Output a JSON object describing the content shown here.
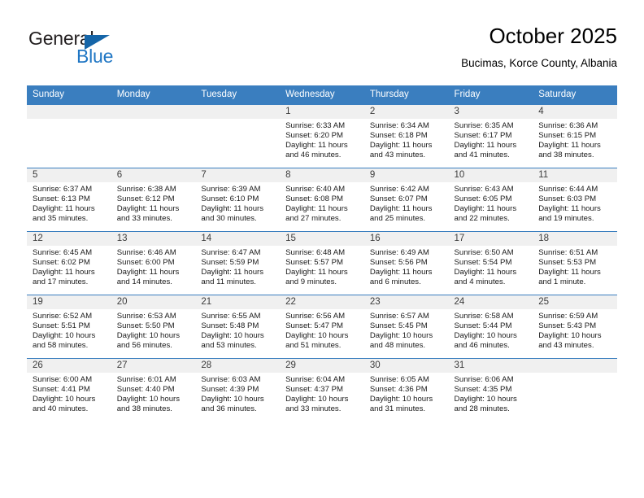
{
  "brand": {
    "name_part1": "General",
    "name_part2": "Blue",
    "triangle_icon": "triangle-icon",
    "accent_color": "#1f76c4",
    "dark_color": "#231f20"
  },
  "header": {
    "title": "October 2025",
    "subtitle": "Bucimas, Korce County, Albania"
  },
  "calendar": {
    "header_bg": "#3a7ebf",
    "daynum_bg": "#f0f0f0",
    "weekday_headers": [
      "Sunday",
      "Monday",
      "Tuesday",
      "Wednesday",
      "Thursday",
      "Friday",
      "Saturday"
    ],
    "weeks": [
      [
        {
          "day": "",
          "lines": []
        },
        {
          "day": "",
          "lines": []
        },
        {
          "day": "",
          "lines": []
        },
        {
          "day": "1",
          "lines": [
            "Sunrise: 6:33 AM",
            "Sunset: 6:20 PM",
            "Daylight: 11 hours",
            "and 46 minutes."
          ]
        },
        {
          "day": "2",
          "lines": [
            "Sunrise: 6:34 AM",
            "Sunset: 6:18 PM",
            "Daylight: 11 hours",
            "and 43 minutes."
          ]
        },
        {
          "day": "3",
          "lines": [
            "Sunrise: 6:35 AM",
            "Sunset: 6:17 PM",
            "Daylight: 11 hours",
            "and 41 minutes."
          ]
        },
        {
          "day": "4",
          "lines": [
            "Sunrise: 6:36 AM",
            "Sunset: 6:15 PM",
            "Daylight: 11 hours",
            "and 38 minutes."
          ]
        }
      ],
      [
        {
          "day": "5",
          "lines": [
            "Sunrise: 6:37 AM",
            "Sunset: 6:13 PM",
            "Daylight: 11 hours",
            "and 35 minutes."
          ]
        },
        {
          "day": "6",
          "lines": [
            "Sunrise: 6:38 AM",
            "Sunset: 6:12 PM",
            "Daylight: 11 hours",
            "and 33 minutes."
          ]
        },
        {
          "day": "7",
          "lines": [
            "Sunrise: 6:39 AM",
            "Sunset: 6:10 PM",
            "Daylight: 11 hours",
            "and 30 minutes."
          ]
        },
        {
          "day": "8",
          "lines": [
            "Sunrise: 6:40 AM",
            "Sunset: 6:08 PM",
            "Daylight: 11 hours",
            "and 27 minutes."
          ]
        },
        {
          "day": "9",
          "lines": [
            "Sunrise: 6:42 AM",
            "Sunset: 6:07 PM",
            "Daylight: 11 hours",
            "and 25 minutes."
          ]
        },
        {
          "day": "10",
          "lines": [
            "Sunrise: 6:43 AM",
            "Sunset: 6:05 PM",
            "Daylight: 11 hours",
            "and 22 minutes."
          ]
        },
        {
          "day": "11",
          "lines": [
            "Sunrise: 6:44 AM",
            "Sunset: 6:03 PM",
            "Daylight: 11 hours",
            "and 19 minutes."
          ]
        }
      ],
      [
        {
          "day": "12",
          "lines": [
            "Sunrise: 6:45 AM",
            "Sunset: 6:02 PM",
            "Daylight: 11 hours",
            "and 17 minutes."
          ]
        },
        {
          "day": "13",
          "lines": [
            "Sunrise: 6:46 AM",
            "Sunset: 6:00 PM",
            "Daylight: 11 hours",
            "and 14 minutes."
          ]
        },
        {
          "day": "14",
          "lines": [
            "Sunrise: 6:47 AM",
            "Sunset: 5:59 PM",
            "Daylight: 11 hours",
            "and 11 minutes."
          ]
        },
        {
          "day": "15",
          "lines": [
            "Sunrise: 6:48 AM",
            "Sunset: 5:57 PM",
            "Daylight: 11 hours",
            "and 9 minutes."
          ]
        },
        {
          "day": "16",
          "lines": [
            "Sunrise: 6:49 AM",
            "Sunset: 5:56 PM",
            "Daylight: 11 hours",
            "and 6 minutes."
          ]
        },
        {
          "day": "17",
          "lines": [
            "Sunrise: 6:50 AM",
            "Sunset: 5:54 PM",
            "Daylight: 11 hours",
            "and 4 minutes."
          ]
        },
        {
          "day": "18",
          "lines": [
            "Sunrise: 6:51 AM",
            "Sunset: 5:53 PM",
            "Daylight: 11 hours",
            "and 1 minute."
          ]
        }
      ],
      [
        {
          "day": "19",
          "lines": [
            "Sunrise: 6:52 AM",
            "Sunset: 5:51 PM",
            "Daylight: 10 hours",
            "and 58 minutes."
          ]
        },
        {
          "day": "20",
          "lines": [
            "Sunrise: 6:53 AM",
            "Sunset: 5:50 PM",
            "Daylight: 10 hours",
            "and 56 minutes."
          ]
        },
        {
          "day": "21",
          "lines": [
            "Sunrise: 6:55 AM",
            "Sunset: 5:48 PM",
            "Daylight: 10 hours",
            "and 53 minutes."
          ]
        },
        {
          "day": "22",
          "lines": [
            "Sunrise: 6:56 AM",
            "Sunset: 5:47 PM",
            "Daylight: 10 hours",
            "and 51 minutes."
          ]
        },
        {
          "day": "23",
          "lines": [
            "Sunrise: 6:57 AM",
            "Sunset: 5:45 PM",
            "Daylight: 10 hours",
            "and 48 minutes."
          ]
        },
        {
          "day": "24",
          "lines": [
            "Sunrise: 6:58 AM",
            "Sunset: 5:44 PM",
            "Daylight: 10 hours",
            "and 46 minutes."
          ]
        },
        {
          "day": "25",
          "lines": [
            "Sunrise: 6:59 AM",
            "Sunset: 5:43 PM",
            "Daylight: 10 hours",
            "and 43 minutes."
          ]
        }
      ],
      [
        {
          "day": "26",
          "lines": [
            "Sunrise: 6:00 AM",
            "Sunset: 4:41 PM",
            "Daylight: 10 hours",
            "and 40 minutes."
          ]
        },
        {
          "day": "27",
          "lines": [
            "Sunrise: 6:01 AM",
            "Sunset: 4:40 PM",
            "Daylight: 10 hours",
            "and 38 minutes."
          ]
        },
        {
          "day": "28",
          "lines": [
            "Sunrise: 6:03 AM",
            "Sunset: 4:39 PM",
            "Daylight: 10 hours",
            "and 36 minutes."
          ]
        },
        {
          "day": "29",
          "lines": [
            "Sunrise: 6:04 AM",
            "Sunset: 4:37 PM",
            "Daylight: 10 hours",
            "and 33 minutes."
          ]
        },
        {
          "day": "30",
          "lines": [
            "Sunrise: 6:05 AM",
            "Sunset: 4:36 PM",
            "Daylight: 10 hours",
            "and 31 minutes."
          ]
        },
        {
          "day": "31",
          "lines": [
            "Sunrise: 6:06 AM",
            "Sunset: 4:35 PM",
            "Daylight: 10 hours",
            "and 28 minutes."
          ]
        },
        {
          "day": "",
          "lines": []
        }
      ]
    ]
  }
}
